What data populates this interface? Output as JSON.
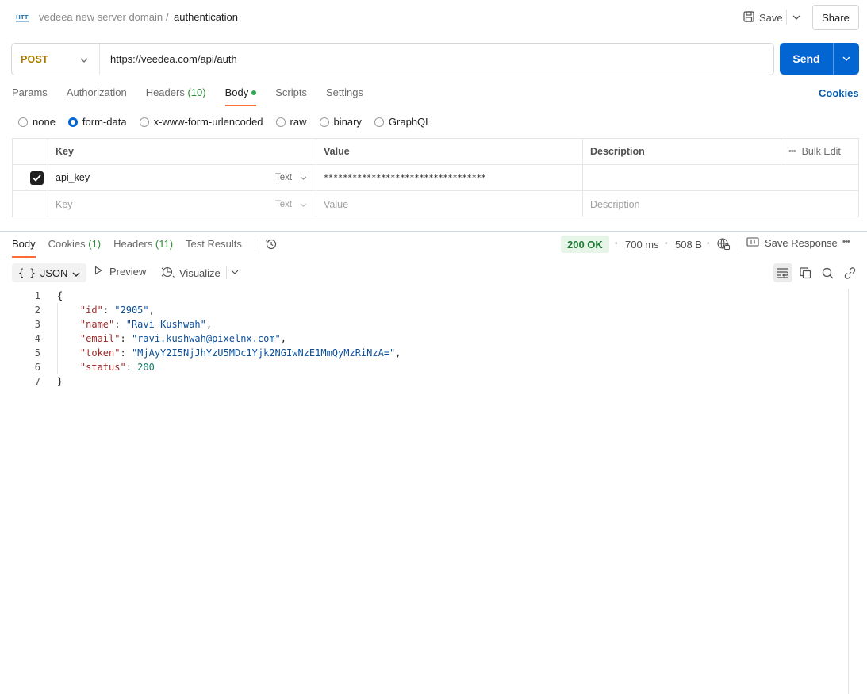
{
  "header": {
    "method_badge": "HTTP",
    "collection": "vedeea new server domain",
    "separator": "/",
    "request_name": "authentication",
    "save_label": "Save",
    "share_label": "Share"
  },
  "request": {
    "method": "POST",
    "url": "https://veedea.com/api/auth",
    "send_label": "Send"
  },
  "request_tabs": [
    {
      "label": "Params",
      "count": ""
    },
    {
      "label": "Authorization",
      "count": ""
    },
    {
      "label": "Headers",
      "count": "(10)"
    },
    {
      "label": "Body",
      "count": ""
    },
    {
      "label": "Scripts",
      "count": ""
    },
    {
      "label": "Settings",
      "count": ""
    }
  ],
  "active_request_tab": "Body",
  "cookies_link": "Cookies",
  "body_types": [
    "none",
    "form-data",
    "x-www-form-urlencoded",
    "raw",
    "binary",
    "GraphQL"
  ],
  "selected_body_type": "form-data",
  "form_table": {
    "headers": {
      "key": "Key",
      "value": "Value",
      "description": "Description",
      "bulk_edit": "Bulk Edit"
    },
    "rows": [
      {
        "checked": true,
        "key": "api_key",
        "type": "Text",
        "value": "**********************************",
        "description": ""
      }
    ],
    "placeholder": {
      "key": "Key",
      "type": "Text",
      "value": "Value",
      "description": "Description"
    }
  },
  "response_tabs": [
    {
      "label": "Body",
      "count": ""
    },
    {
      "label": "Cookies",
      "count": "(1)"
    },
    {
      "label": "Headers",
      "count": "(11)"
    },
    {
      "label": "Test Results",
      "count": ""
    }
  ],
  "response_meta": {
    "status": "200 OK",
    "time": "700 ms",
    "size": "508 B",
    "save_response": "Save Response"
  },
  "response_toolbar": {
    "format": "JSON",
    "format_icon": "{ }",
    "preview": "Preview",
    "visualize": "Visualize"
  },
  "response_body": {
    "line_numbers": [
      "1",
      "2",
      "3",
      "4",
      "5",
      "6",
      "7"
    ],
    "open_brace": "{",
    "close_brace": "}",
    "fields": [
      {
        "key": "\"id\"",
        "value": "\"2905\"",
        "trail": ",",
        "kind": "s"
      },
      {
        "key": "\"name\"",
        "value": "\"Ravi Kushwah\"",
        "trail": ",",
        "kind": "s"
      },
      {
        "key": "\"email\"",
        "value": "\"ravi.kushwah@pixelnx.com\"",
        "trail": ",",
        "kind": "s"
      },
      {
        "key": "\"token\"",
        "value": "\"MjAyY2I5NjJhYzU5MDc1Yjk2NGIwNzE1MmQyMzRiNzA=\"",
        "trail": ",",
        "kind": "s"
      },
      {
        "key": "\"status\"",
        "value": "200",
        "trail": "",
        "kind": "n"
      }
    ]
  },
  "colors": {
    "accent_orange": "#ff6c37",
    "send_blue": "#0265d2",
    "method_post": "#a77c00",
    "status_ok": "#1f7a35"
  }
}
